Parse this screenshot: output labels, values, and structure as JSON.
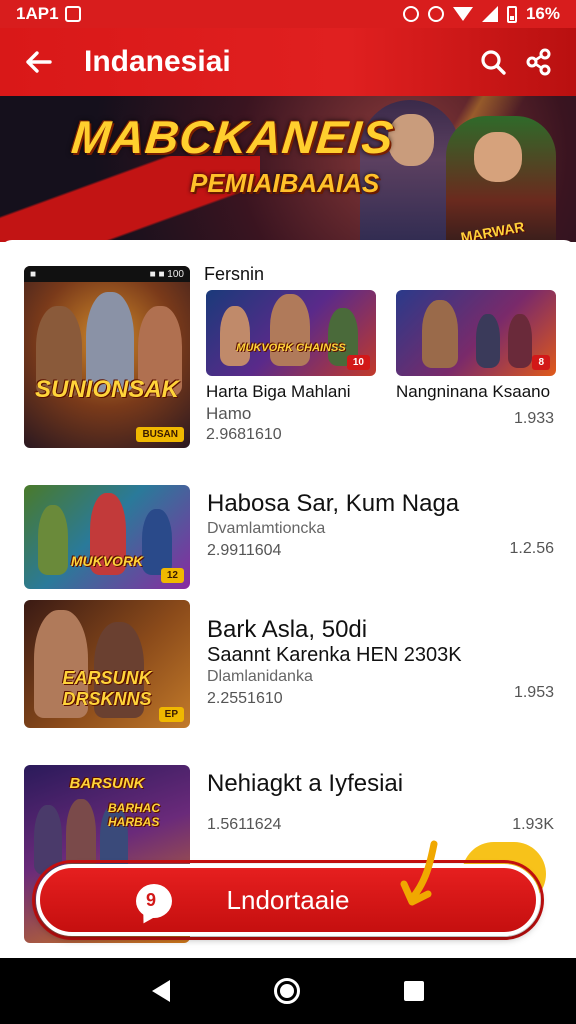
{
  "status_bar": {
    "time": "1AP1",
    "battery": "16%"
  },
  "app_bar": {
    "title": "Indanesiai",
    "back_icon": "arrow-left-icon",
    "search_icon": "search-icon",
    "share_icon": "share-icon"
  },
  "banner": {
    "heading": "MABCKANEIS",
    "subheading": "PEMIAIBAAIAS",
    "hero_badge": "MARWAR"
  },
  "section": {
    "title": "Fersnin",
    "featured": {
      "art_title": "SUNIONSAK",
      "art_topbar_left": "■",
      "art_topbar_right": "■ ■ 100",
      "art_chip": "BUSAN"
    },
    "grid": [
      {
        "art_title": "MUKVORK CHAINSS",
        "art_badge": "10",
        "title": "Harta Biga Mahlani",
        "sub": "Hamo",
        "count": "2.9681610"
      },
      {
        "art_badge": "8",
        "title": "Nangninana Ksaano",
        "size": "1.933"
      }
    ]
  },
  "list": [
    {
      "art_title": "MUKVORK",
      "art_badge": "12",
      "title": "Habosa Sar, Kum Naga",
      "developer": "Dvamlamtioncka",
      "count": "2.9911604",
      "size": "1.2.56"
    },
    {
      "art_title": "EARSUNK DRSKNNS",
      "art_badge": "EP",
      "title": "Bark Asla, 50di",
      "subtitle": "Saannt Karenka HEN 2303K",
      "developer": "Dlamlanidanka",
      "count": "2.2551610",
      "size": "1.953"
    },
    {
      "art_title": "BARSUNK",
      "art_title_2": "BARHAC HARBAS",
      "title": "Nehiagkt a Iyfesiai",
      "count": "1.5611624",
      "size": "1.93K"
    }
  ],
  "cta": {
    "label": "Lndortaaie",
    "icon": "chat-bubble-icon"
  },
  "colors": {
    "brand": "#d81d1d",
    "accent": "#ffcf2e"
  }
}
